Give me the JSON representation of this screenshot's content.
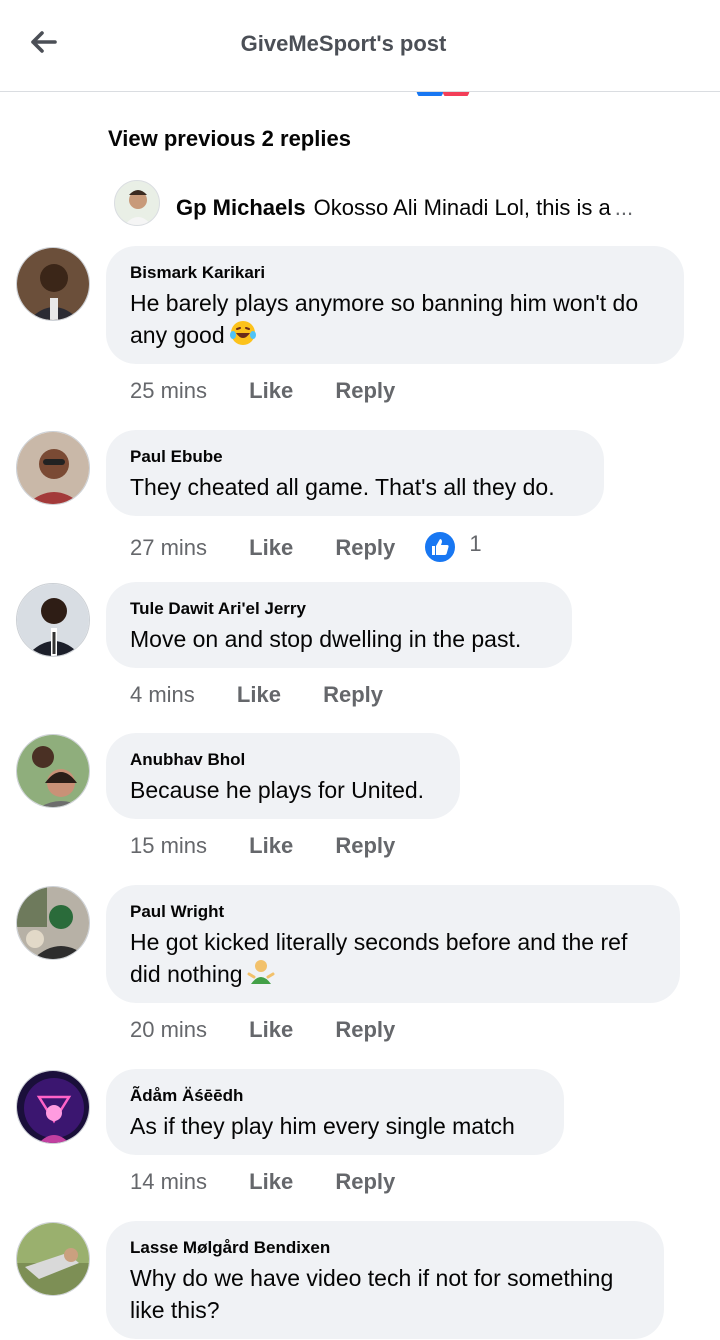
{
  "header": {
    "title": "GiveMeSport's post"
  },
  "thread": {
    "view_previous": "View previous 2 replies",
    "latest_reply": {
      "author": "Gp Michaels",
      "text": "Okosso Ali Minadi Lol, this is a",
      "ellipsis": "..."
    }
  },
  "actions": {
    "like": "Like",
    "reply": "Reply"
  },
  "comments": [
    {
      "author": "Bismark Karikari",
      "text": "He barely plays anymore so banning him won't do any good",
      "emoji": "laughing-tears",
      "time": "25 mins"
    },
    {
      "author": "Paul Ebube",
      "text": "They cheated all game. That's all they do.",
      "time": "27 mins",
      "reactions": {
        "type": "like",
        "count": "1"
      }
    },
    {
      "author": "Tule Dawit Ari'el Jerry",
      "text": "Move on and stop dwelling in the past.",
      "time": "4 mins"
    },
    {
      "author": "Anubhav Bhol",
      "text": "Because he plays for United.",
      "time": "15 mins"
    },
    {
      "author": "Paul Wright",
      "text": "He got kicked literally seconds before and the ref did nothing",
      "emoji": "person-shrugging",
      "time": "20 mins"
    },
    {
      "author": "Ãdåm Äśēēdh",
      "text": "As if they play him every single match",
      "time": "14 mins"
    },
    {
      "author": "Lasse Mølgård Bendixen",
      "text": "Why do we have video tech if not for something like this?"
    }
  ],
  "colors": {
    "bubble": "#f0f2f5",
    "meta_text": "#65676b",
    "like_blue": "#1877f2",
    "header_title": "#4b4f56"
  },
  "icons": {
    "back": "arrow-left-icon",
    "like_reaction": "thumbs-up-icon"
  }
}
